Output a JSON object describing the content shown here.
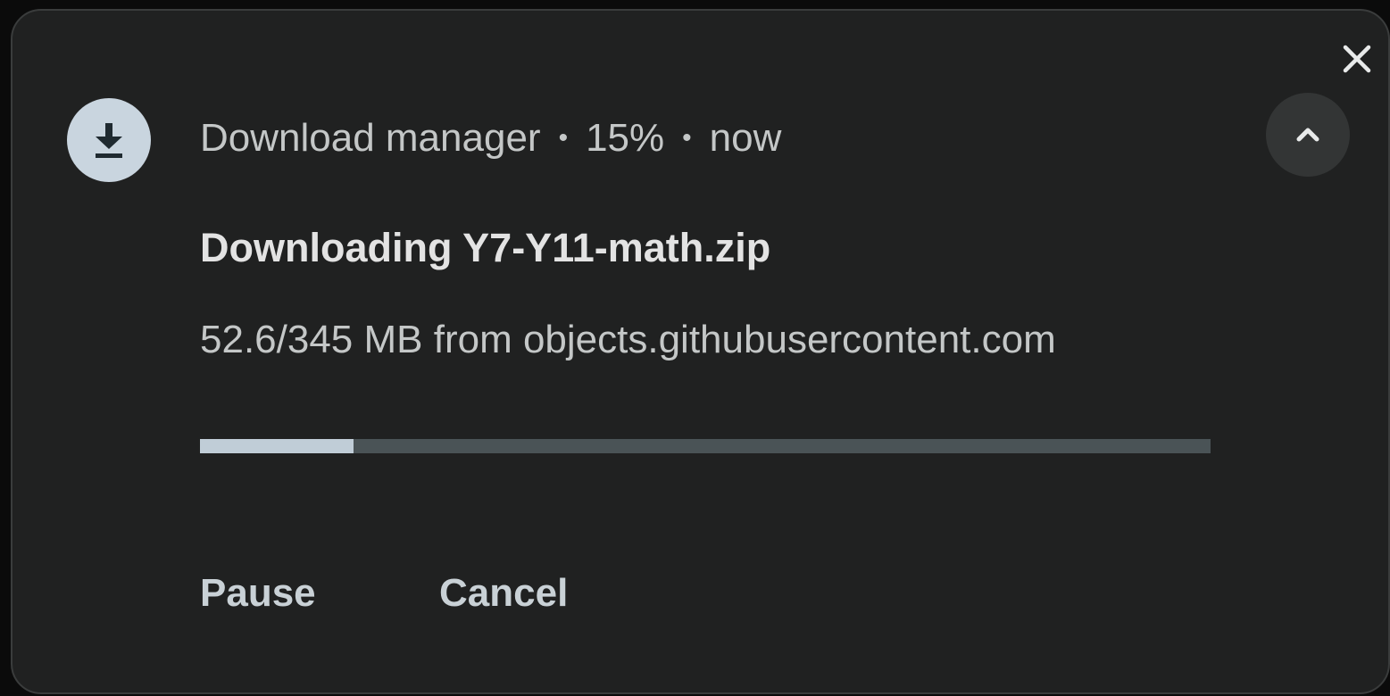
{
  "notification": {
    "app_name": "Download manager",
    "separator": "•",
    "progress_text": "15%",
    "time": "now",
    "title": "Downloading Y7-Y11-math.zip",
    "subtitle": "52.6/345 MB from objects.githubusercontent.com",
    "progress_fraction": 0.152,
    "icons": {
      "app": "download-icon",
      "close": "close-icon",
      "expand": "chevron-up-icon"
    }
  },
  "actions": {
    "pause_label": "Pause",
    "cancel_label": "Cancel"
  },
  "colors": {
    "card_background": "#202121",
    "progress_fill": "#c0cdd7",
    "progress_track": "#4a5356",
    "icon_background": "#c9d5df"
  }
}
